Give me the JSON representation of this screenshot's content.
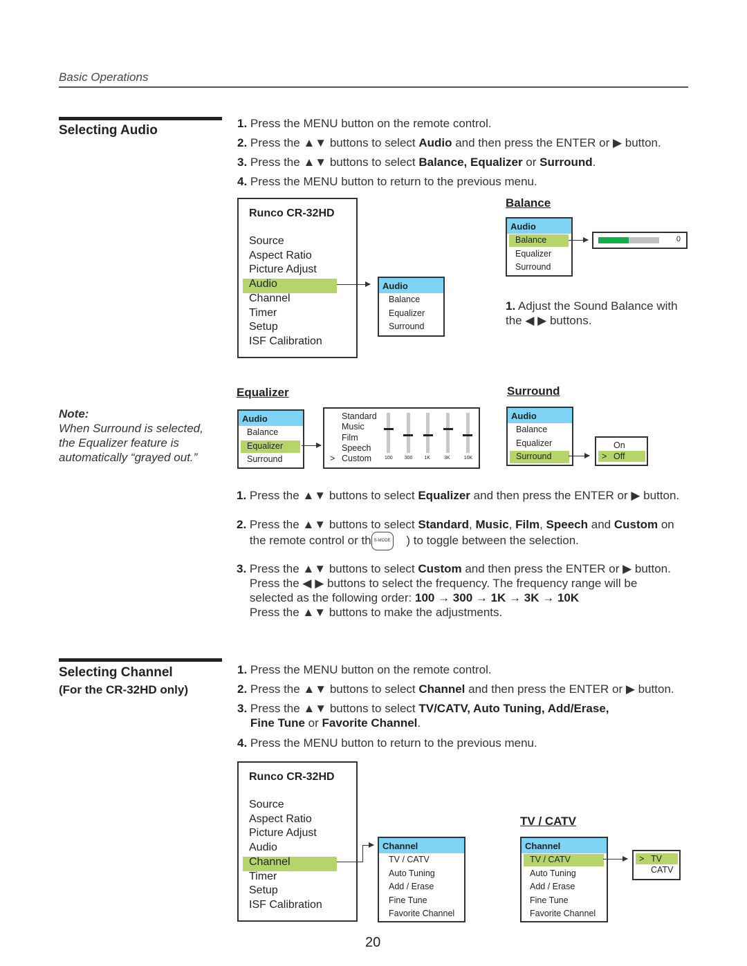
{
  "header": {
    "section": "Basic Operations",
    "page_number": "20"
  },
  "audio": {
    "title": "Selecting Audio",
    "steps": [
      [
        {
          "t": "1.",
          "b": true
        },
        {
          "t": " Press the MENU button on the remote control."
        }
      ],
      [
        {
          "t": "2.",
          "b": true
        },
        {
          "t": " Press the ▲▼ buttons to select "
        },
        {
          "t": "Audio",
          "b": true
        },
        {
          "t": " and then press the ENTER or ▶ button."
        }
      ],
      [
        {
          "t": "3.",
          "b": true
        },
        {
          "t": " Press the ▲▼ buttons to select "
        },
        {
          "t": "Balance, Equalizer",
          "b": true
        },
        {
          "t": " or "
        },
        {
          "t": "Surround",
          "b": true
        },
        {
          "t": "."
        }
      ],
      [
        {
          "t": "4.",
          "b": true
        },
        {
          "t": " Press the MENU button to return to the previous menu."
        }
      ]
    ],
    "main_menu": {
      "title": "Runco CR-32HD",
      "items": [
        "Source",
        "Aspect Ratio",
        "Picture Adjust",
        "Audio",
        "Channel",
        "Timer",
        "Setup",
        "ISF Calibration"
      ],
      "selected": "Audio"
    },
    "submenu": {
      "header": "Audio",
      "items": [
        "Balance",
        "Equalizer",
        "Surround"
      ]
    },
    "balance": {
      "title": "Balance",
      "selected": "Balance",
      "value": "0",
      "level_percent": 50,
      "text": [
        [
          {
            "t": "1.",
            "b": true
          },
          {
            "t": " Adjust the Sound Balance with"
          }
        ],
        [
          {
            "t": "the ◀ ▶ buttons."
          }
        ]
      ]
    },
    "equalizer": {
      "title": "Equalizer",
      "selected": "Equalizer",
      "modes": [
        "Standard",
        "Music",
        "Film",
        "Speech",
        "Custom"
      ],
      "current_mode": "Custom",
      "cursor": ">",
      "bands": [
        {
          "label": "100",
          "level": 0.6
        },
        {
          "label": "300",
          "level": 0.45
        },
        {
          "label": "1K",
          "level": 0.45
        },
        {
          "label": "3K",
          "level": 0.6
        },
        {
          "label": "10K",
          "level": 0.45
        }
      ]
    },
    "surround": {
      "title": "Surround",
      "selected": "Surround",
      "options": [
        "On",
        "Off"
      ],
      "current": "Off",
      "cursor": ">"
    },
    "note": {
      "title": "Note:",
      "lines": [
        "When Surround is selected,",
        "the Equalizer feature is",
        "automatically “grayed out.”"
      ]
    },
    "eq_steps": [
      [
        [
          {
            "t": "1.",
            "b": true
          },
          {
            "t": " Press the ▲▼ buttons to select "
          },
          {
            "t": "Equalizer",
            "b": true
          },
          {
            "t": " and then press the ENTER or ▶ button."
          }
        ]
      ],
      [
        [
          {
            "t": "2.",
            "b": true
          },
          {
            "t": " Press the ▲▼ buttons to select "
          },
          {
            "t": "Standard",
            "b": true
          },
          {
            "t": ", "
          },
          {
            "t": "Music",
            "b": true
          },
          {
            "t": ", "
          },
          {
            "t": "Film",
            "b": true
          },
          {
            "t": ", "
          },
          {
            "t": "Speech",
            "b": true
          },
          {
            "t": " and "
          },
          {
            "t": "Custom",
            "b": true
          },
          {
            "t": " on"
          }
        ],
        [
          {
            "t": "    the remote control or th"
          },
          {
            "t": "S-MODE",
            "icon": true
          },
          {
            "t": " ) to toggle between the selection."
          }
        ]
      ],
      [
        [
          {
            "t": "3.",
            "b": true
          },
          {
            "t": " Press the ▲▼ buttons to select "
          },
          {
            "t": "Custom",
            "b": true
          },
          {
            "t": " and then press the ENTER or ▶ button."
          }
        ],
        [
          {
            "t": "    Press the ◀ ▶ buttons to select the frequency. The frequency range will be"
          }
        ],
        [
          {
            "t": "    selected as the following order: "
          },
          {
            "t": "100 → 300 → 1K → 3K → 10K",
            "b": true
          }
        ],
        [
          {
            "t": "    Press the ▲▼ buttons to make the adjustments."
          }
        ]
      ]
    ]
  },
  "channel": {
    "title": "Selecting Channel",
    "subtitle": "(For the CR-32HD only)",
    "steps": [
      [
        [
          {
            "t": "1.",
            "b": true
          },
          {
            "t": " Press the MENU button on the remote control."
          }
        ]
      ],
      [
        [
          {
            "t": "2.",
            "b": true
          },
          {
            "t": " Press the ▲▼ buttons to select "
          },
          {
            "t": "Channel",
            "b": true
          },
          {
            "t": " and then press the ENTER or ▶ button."
          }
        ]
      ],
      [
        [
          {
            "t": "3.",
            "b": true
          },
          {
            "t": " Press the ▲▼ buttons to select "
          },
          {
            "t": "TV/CATV, Auto Tuning, Add/Erase,",
            "b": true
          }
        ],
        [
          {
            "t": "    "
          },
          {
            "t": "Fine Tune",
            "b": true
          },
          {
            "t": " or "
          },
          {
            "t": "Favorite Channel",
            "b": true
          },
          {
            "t": "."
          }
        ]
      ],
      [
        [
          {
            "t": "4.",
            "b": true
          },
          {
            "t": " Press the MENU button to return to the previous menu."
          }
        ]
      ]
    ],
    "main_menu": {
      "title": "Runco CR-32HD",
      "items": [
        "Source",
        "Aspect Ratio",
        "Picture Adjust",
        "Audio",
        "Channel",
        "Timer",
        "Setup",
        "ISF Calibration"
      ],
      "selected": "Channel"
    },
    "submenu": {
      "header": "Channel",
      "items": [
        "TV / CATV",
        "Auto Tuning",
        "Add / Erase",
        "Fine Tune",
        "Favorite Channel"
      ]
    },
    "tvcatv": {
      "title": "TV / CATV",
      "selected": "TV / CATV",
      "options": [
        "TV",
        "CATV"
      ],
      "current": "TV",
      "cursor": ">"
    }
  },
  "colors": {
    "highlight": "#b5d56a",
    "menu_header": "#7fd3f5",
    "balance_bar": "#12b04a",
    "bar_track": "#c0c0c0"
  }
}
